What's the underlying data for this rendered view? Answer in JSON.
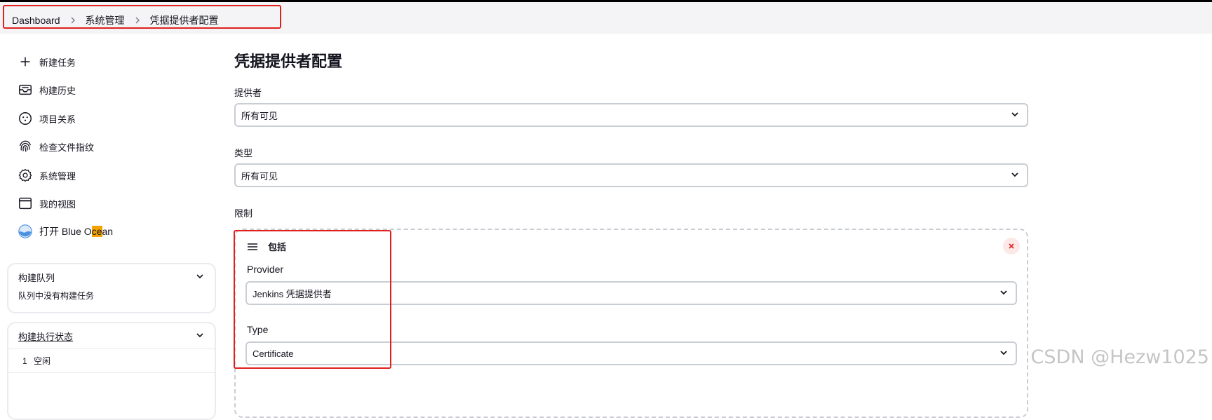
{
  "breadcrumb": [
    "Dashboard",
    "系统管理",
    "凭据提供者配置"
  ],
  "sidebar": {
    "items": [
      {
        "label": "新建任务",
        "icon": "plus-icon"
      },
      {
        "label": "构建历史",
        "icon": "inbox-icon"
      },
      {
        "label": "项目关系",
        "icon": "relation-icon"
      },
      {
        "label": "检查文件指纹",
        "icon": "fingerprint-icon"
      },
      {
        "label": "系统管理",
        "icon": "gear-icon"
      },
      {
        "label": "我的视图",
        "icon": "window-icon"
      }
    ],
    "blue_ocean": {
      "prefix": "打开 Blue O",
      "highlight": "ce",
      "suffix": "an",
      "icon": "blue-ocean-icon"
    },
    "build_queue": {
      "title": "构建队列",
      "empty": "队列中没有构建任务"
    },
    "executor_status": {
      "title": "构建执行状态",
      "rows": [
        {
          "num": "1",
          "status": "空闲"
        }
      ]
    }
  },
  "main": {
    "title": "凭据提供者配置",
    "provider": {
      "label": "提供者",
      "value": "所有可见"
    },
    "type": {
      "label": "类型",
      "value": "所有可见"
    },
    "restriction": {
      "label": "限制",
      "item": {
        "title": "包括",
        "provider_label": "Provider",
        "provider_value": "Jenkins 凭据提供者",
        "type_label": "Type",
        "type_value": "Certificate"
      }
    }
  },
  "watermark": "CSDN @Hezw1025",
  "colors": {
    "annotation_red": "#e0201c",
    "blue_ocean": "#4a90e2",
    "highlight": "#f6a300"
  }
}
